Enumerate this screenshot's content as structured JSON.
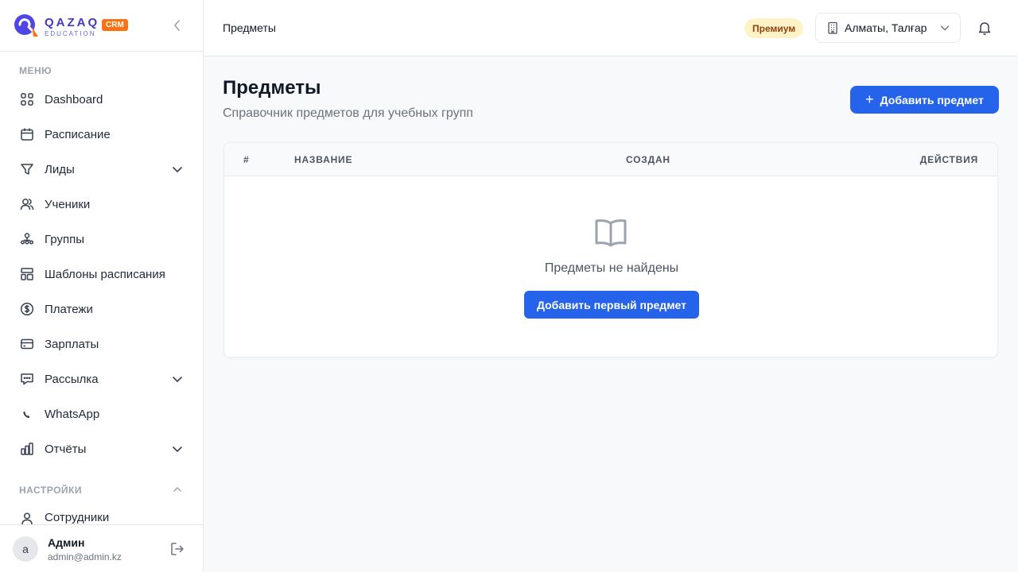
{
  "brand": {
    "name": "QAZAQ",
    "tagline": "EDUCATION",
    "badge": "CRM",
    "badge_color": "#f97316"
  },
  "sidebar": {
    "menu_title": "МЕНЮ",
    "items": [
      {
        "label": "Dashboard",
        "icon": "dashboard-icon"
      },
      {
        "label": "Расписание",
        "icon": "calendar-icon"
      },
      {
        "label": "Лиды",
        "icon": "funnel-icon",
        "expandable": true
      },
      {
        "label": "Ученики",
        "icon": "users-icon"
      },
      {
        "label": "Группы",
        "icon": "groups-icon"
      },
      {
        "label": "Шаблоны расписания",
        "icon": "template-icon"
      },
      {
        "label": "Платежи",
        "icon": "dollar-icon"
      },
      {
        "label": "Зарплаты",
        "icon": "card-icon"
      },
      {
        "label": "Рассылка",
        "icon": "chat-icon",
        "expandable": true
      },
      {
        "label": "WhatsApp",
        "icon": "phone-icon"
      },
      {
        "label": "Отчёты",
        "icon": "chart-icon",
        "expandable": true
      }
    ],
    "settings_title": "НАСТРОЙКИ",
    "settings_items": [
      {
        "label": "Сотрудники",
        "icon": "user-icon"
      }
    ]
  },
  "user": {
    "initial": "a",
    "name": "Админ",
    "email": "admin@admin.kz"
  },
  "header": {
    "title": "Предметы",
    "plan": "Премиум",
    "branch": "Алматы, Талғар"
  },
  "main": {
    "title": "Предметы",
    "subtitle": "Справочник предметов для учебных групп",
    "add_button": "Добавить предмет",
    "add_button_icon": "+",
    "accent_color": "#2563eb",
    "table": {
      "columns": [
        "#",
        "НАЗВАНИЕ",
        "СОЗДАН",
        "ДЕЙСТВИЯ"
      ],
      "rows": []
    },
    "empty": {
      "icon": "book-icon",
      "text": "Предметы не найдены",
      "button": "Добавить первый предмет"
    }
  }
}
